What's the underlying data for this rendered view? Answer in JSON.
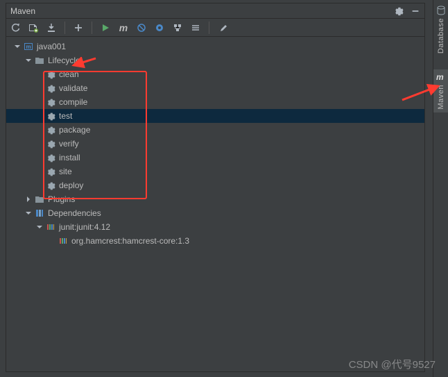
{
  "panel": {
    "title": "Maven"
  },
  "toolbar": {
    "reimport": "Reimport",
    "generate": "Generate",
    "download": "Download",
    "add": "Add",
    "run": "Run",
    "m": "m",
    "skip_tests": "Toggle Skip Tests",
    "cycle": "Offline",
    "collapse": "Collapse",
    "expand": "Expand",
    "settings_wrench": "Settings"
  },
  "tree": {
    "root": "java001",
    "lifecycle": {
      "label": "Lifecycle",
      "items": [
        "clean",
        "validate",
        "compile",
        "test",
        "package",
        "verify",
        "install",
        "site",
        "deploy"
      ],
      "selected": "test"
    },
    "plugins": "Plugins",
    "dependencies": {
      "label": "Dependencies",
      "junit": "junit:junit:4.12",
      "hamcrest": "org.hamcrest:hamcrest-core:1.3"
    }
  },
  "side_tabs": {
    "database": "Database",
    "maven": "Maven"
  },
  "watermark": "CSDN @代号9527"
}
